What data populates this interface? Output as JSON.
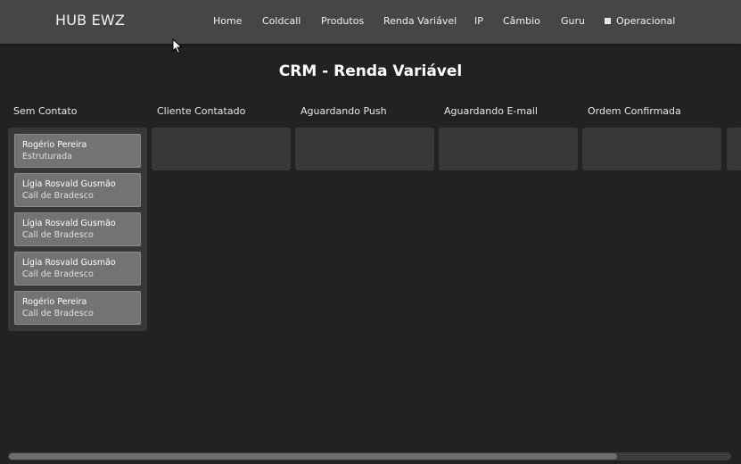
{
  "navbar": {
    "brand": "HUB EWZ",
    "items": [
      {
        "label": "Home"
      },
      {
        "label": "Coldcall"
      },
      {
        "label": "Produtos"
      },
      {
        "label": "Renda Variável"
      },
      {
        "label": "IP"
      },
      {
        "label": "Câmbio"
      },
      {
        "label": "Guru"
      },
      {
        "label": "Operacional",
        "icon": "square-bullet-icon"
      }
    ]
  },
  "page": {
    "title": "CRM - Renda Variável"
  },
  "board": {
    "columns": [
      {
        "title": "Sem Contato",
        "cards": [
          {
            "name": "Rogério Pereira",
            "subtitle": "Estruturada"
          },
          {
            "name": "Lígia Rosvald Gusmão",
            "subtitle": "Call de Bradesco"
          },
          {
            "name": "Lígia Rosvald Gusmão",
            "subtitle": "Call de Bradesco"
          },
          {
            "name": "Lígia Rosvald Gusmão",
            "subtitle": "Call de Bradesco"
          },
          {
            "name": "Rogério Pereira",
            "subtitle": "Call de Bradesco"
          }
        ]
      },
      {
        "title": "Cliente Contatado",
        "cards": []
      },
      {
        "title": "Aguardando Push",
        "cards": []
      },
      {
        "title": "Aguardando E-mail",
        "cards": []
      },
      {
        "title": "Ordem Confirmada",
        "cards": []
      },
      {
        "title": "",
        "cards": []
      }
    ]
  },
  "scrollbar": {
    "horizontal_position": 0.0
  },
  "colors": {
    "background": "#222222",
    "navbar": "#464646",
    "column": "#383838",
    "card": "#737373"
  }
}
